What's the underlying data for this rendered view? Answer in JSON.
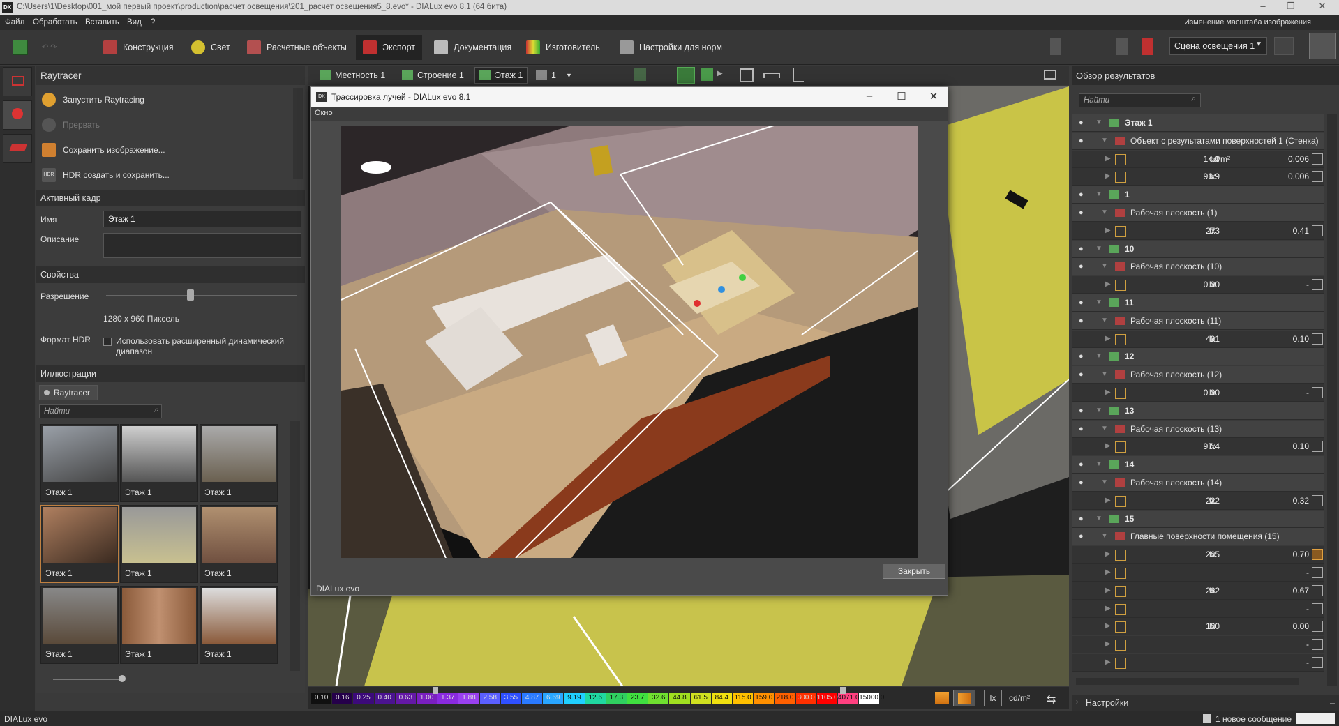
{
  "window": {
    "title": "C:\\Users\\1\\Desktop\\001_мой первый проект\\production\\расчет освещения\\201_расчет освещения5_8.evo* - DIALux evo 8.1  (64 бита)",
    "icon_text": "DX",
    "controls": {
      "min": "–",
      "max": "❐",
      "close": "✕"
    }
  },
  "menu": {
    "items": [
      "Файл",
      "Обработать",
      "Вставить",
      "Вид",
      "?"
    ],
    "right_text": "Изменение масштаба изображения"
  },
  "toolbar": {
    "tabs": [
      "Конструкция",
      "Свет",
      "Расчетные объекты",
      "Экспорт",
      "Документация",
      "Изготовитель",
      "Настройки для норм"
    ],
    "active": "Экспорт",
    "scene": "Сцена освещения 1"
  },
  "left_panel": {
    "title": "Raytracer",
    "actions": [
      "Запустить Raytracing",
      "Прервать",
      "Сохранить изображение...",
      "HDR создать и сохранить..."
    ],
    "active_frame": {
      "header": "Активный кадр",
      "name_label": "Имя",
      "name_value": "Этаж 1",
      "desc_label": "Описание",
      "desc_value": ""
    },
    "properties": {
      "header": "Свойства",
      "resolution_label": "Разрешение",
      "resolution_value": "1280 x 960 Пиксель",
      "resolution_slider": 0.5,
      "hdr_label": "Формат HDR",
      "hdr_checkbox": "Использовать расширенный динамический диапазон",
      "hdr_checked": false
    },
    "illustrations": {
      "header": "Иллюстрации",
      "tab": "Raytracer",
      "search_placeholder": "Найти",
      "thumbs": [
        "Этаж 1",
        "Этаж 1",
        "Этаж 1",
        "Этаж 1",
        "Этаж 1",
        "Этаж 1",
        "Этаж 1",
        "Этаж 1",
        "Этаж 1"
      ]
    }
  },
  "center_tabs": [
    "Местность 1",
    "Строение 1",
    "Этаж 1",
    "1"
  ],
  "dialog": {
    "title": "Трассировка лучей - DIALux evo 8.1",
    "menu": "Окно",
    "close_button": "Закрыть",
    "footer": "DIALux evo",
    "controls": {
      "min": "–",
      "max": "☐",
      "close": "✕"
    }
  },
  "colorbar": {
    "values": [
      "0.10",
      "0.16",
      "0.25",
      "0.40",
      "0.63",
      "1.00",
      "1.37",
      "1.88",
      "2.58",
      "3.55",
      "4.87",
      "6.69",
      "9.19",
      "12.6",
      "17.3",
      "23.7",
      "32.6",
      "44.8",
      "61.5",
      "84.4",
      "115.0",
      "159.0",
      "218.0",
      "300.0",
      "1105.0",
      "4071.0",
      "15000.0"
    ],
    "colors": [
      "#101010",
      "#25004a",
      "#3c0a7a",
      "#4b1390",
      "#6418a6",
      "#7a1fc0",
      "#8a2ae0",
      "#9a40f0",
      "#5b5fff",
      "#2f50ff",
      "#2a7aff",
      "#29a6ff",
      "#20d0ff",
      "#20d8a0",
      "#30d060",
      "#40e040",
      "#70e030",
      "#a0e020",
      "#d0e020",
      "#f0e010",
      "#ffc000",
      "#ff9000",
      "#ff6000",
      "#ff3000",
      "#ff0000",
      "#ff4080",
      "#ffffff"
    ],
    "units": [
      "lx",
      "cd/m²"
    ]
  },
  "right_panel": {
    "title": "Обзор результатов",
    "search_placeholder": "Найти",
    "rows": [
      {
        "kind": "group",
        "name": "Этаж 1"
      },
      {
        "kind": "object",
        "name": "Объект с результатами поверхностей 1 (Стенка)"
      },
      {
        "kind": "value",
        "value": "14.0",
        "unit": "cd/m²",
        "ratio": "0.006"
      },
      {
        "kind": "value",
        "value": "96.9",
        "unit": "lx",
        "ratio": "0.006"
      },
      {
        "kind": "group",
        "name": "1"
      },
      {
        "kind": "object",
        "name": "Рабочая плоскость (1)"
      },
      {
        "kind": "value",
        "value": "273",
        "unit": "lx",
        "ratio": "0.41"
      },
      {
        "kind": "group",
        "name": "10"
      },
      {
        "kind": "object",
        "name": "Рабочая плоскость (10)"
      },
      {
        "kind": "value",
        "value": "0.00",
        "unit": "lx",
        "ratio": "-"
      },
      {
        "kind": "group",
        "name": "11"
      },
      {
        "kind": "object",
        "name": "Рабочая плоскость (11)"
      },
      {
        "kind": "value",
        "value": "491",
        "unit": "lx",
        "ratio": "0.10"
      },
      {
        "kind": "group",
        "name": "12"
      },
      {
        "kind": "object",
        "name": "Рабочая плоскость (12)"
      },
      {
        "kind": "value",
        "value": "0.00",
        "unit": "lx",
        "ratio": "-"
      },
      {
        "kind": "group",
        "name": "13"
      },
      {
        "kind": "object",
        "name": "Рабочая плоскость (13)"
      },
      {
        "kind": "value",
        "value": "97.4",
        "unit": "lx",
        "ratio": "0.10"
      },
      {
        "kind": "group",
        "name": "14"
      },
      {
        "kind": "object",
        "name": "Рабочая плоскость (14)"
      },
      {
        "kind": "value",
        "value": "222",
        "unit": "lx",
        "ratio": "0.32"
      },
      {
        "kind": "group",
        "name": "15"
      },
      {
        "kind": "object",
        "name": "Главные поверхности помещения (15)"
      },
      {
        "kind": "value",
        "value": "265",
        "unit": "lx",
        "ratio": "0.70"
      },
      {
        "kind": "value",
        "value": "",
        "unit": "",
        "ratio": "-"
      },
      {
        "kind": "value",
        "value": "262",
        "unit": "lx",
        "ratio": "0.67"
      },
      {
        "kind": "value",
        "value": "",
        "unit": "",
        "ratio": "-"
      },
      {
        "kind": "value",
        "value": "160",
        "unit": "lx",
        "ratio": "0.00"
      },
      {
        "kind": "value",
        "value": "",
        "unit": "",
        "ratio": "-"
      },
      {
        "kind": "value",
        "value": "",
        "unit": "",
        "ratio": "-"
      }
    ],
    "settings": "Настройки"
  },
  "status": {
    "left": "DIALux evo",
    "right": "1 новое сообщение"
  }
}
